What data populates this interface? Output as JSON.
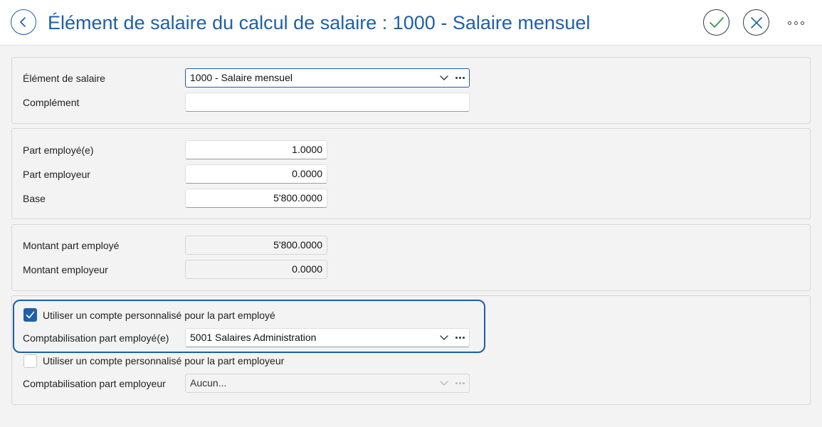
{
  "header": {
    "title": "Élément de salaire du calcul de salaire : 1000 - Salaire mensuel"
  },
  "section1": {
    "element_label": "Élément de salaire",
    "element_value": "1000 - Salaire mensuel",
    "complement_label": "Complément",
    "complement_value": ""
  },
  "section2": {
    "part_employe_label": "Part employé(e)",
    "part_employe_value": "1.0000",
    "part_employeur_label": "Part employeur",
    "part_employeur_value": "0.0000",
    "base_label": "Base",
    "base_value": "5'800.0000"
  },
  "section3": {
    "montant_employe_label": "Montant part employé",
    "montant_employe_value": "5'800.0000",
    "montant_employeur_label": "Montant employeur",
    "montant_employeur_value": "0.0000"
  },
  "section4": {
    "use_custom_employe_label": "Utiliser un compte personnalisé pour la part employé",
    "use_custom_employe_checked": true,
    "compta_employe_label": "Comptabilisation part employé(e)",
    "compta_employe_value": "5001 Salaires Administration",
    "use_custom_employeur_label": "Utiliser un compte personnalisé pour la part employeur",
    "use_custom_employeur_checked": false,
    "compta_employeur_label": "Comptabilisation part employeur",
    "compta_employeur_value": "Aucun..."
  },
  "colors": {
    "accent": "#1f5fa8",
    "background": "#f3f3f3",
    "text": "#222222"
  },
  "icons": {
    "back": "chevron-left-icon",
    "confirm": "check-icon",
    "cancel": "close-icon",
    "more": "more-horizontal-icon",
    "dropdown": "chevron-down-icon",
    "lookup": "ellipsis-icon"
  }
}
